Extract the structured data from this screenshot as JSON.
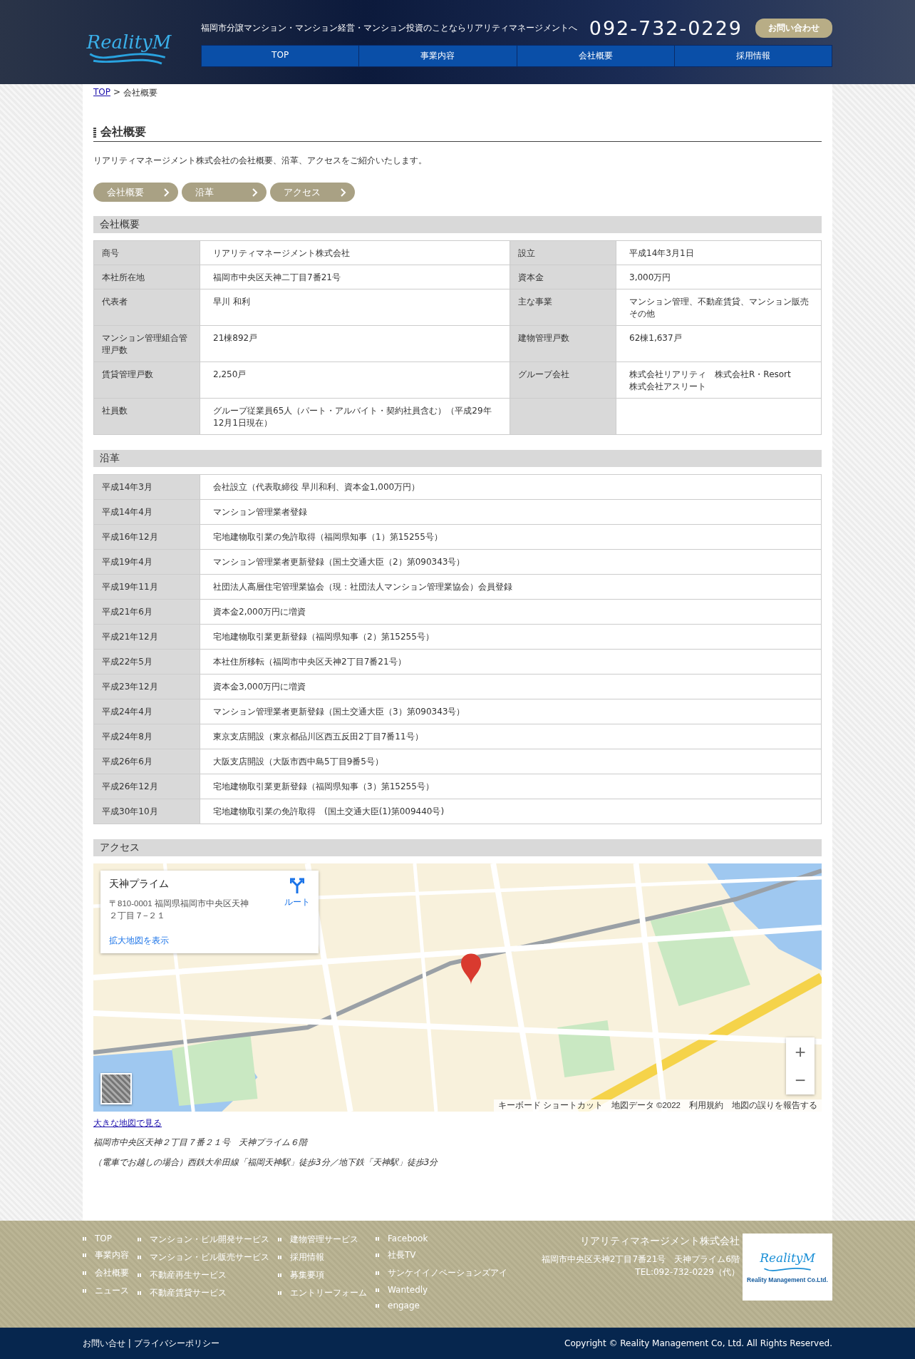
{
  "header": {
    "logo_text": "RealityM",
    "tagline": "福岡市分譲マンション・マンション経営・マンション投資のことならリアリティマネージメントへ",
    "phone": "092-732-0229",
    "contact_button": "お問い合わせ",
    "nav": [
      "TOP",
      "事業内容",
      "会社概要",
      "採用情報"
    ]
  },
  "breadcrumb": {
    "link": "TOP",
    "separator": ">",
    "current": "会社概要"
  },
  "page_title": "会社概要",
  "intro": "リアリティマネージメント株式会社の会社概要、沿革、アクセスをご紹介いたします。",
  "anchors": [
    "会社概要",
    "沿革",
    "アクセス"
  ],
  "company": {
    "heading": "会社概要",
    "rows": [
      {
        "label1": "商号",
        "value1": [
          "リアリティマネージメント株式会社"
        ],
        "label2": "設立",
        "value2": [
          "平成14年3月1日"
        ]
      },
      {
        "label1": "本社所在地",
        "value1": [
          "福岡市中央区天神二丁目7番21号"
        ],
        "label2": "資本金",
        "value2": [
          "3,000万円"
        ]
      },
      {
        "label1": "代表者",
        "value1": [
          "早川 和利"
        ],
        "label2": "主な事業",
        "value2": [
          "マンション管理、不動産賃貸、マンション販売",
          "その他"
        ]
      },
      {
        "label1": "マンション管理組合管理戸数",
        "value1": [
          "21棟892戸"
        ],
        "label2": "建物管理戸数",
        "value2": [
          "62棟1,637戸"
        ]
      },
      {
        "label1": "賃貸管理戸数",
        "value1": [
          "2,250戸"
        ],
        "label2": "グループ会社",
        "value2": [
          "株式会社リアリティ　株式会社R・Resort",
          "株式会社アスリート"
        ]
      },
      {
        "label1": "社員数",
        "value1": [
          "グループ従業員65人（パート・アルバイト・契約社員含む）（平成29年12月1日現在）"
        ]
      }
    ]
  },
  "history": {
    "heading": "沿革",
    "rows": [
      {
        "date": "平成14年3月",
        "event": "会社設立（代表取締役 早川和利、資本金1,000万円）"
      },
      {
        "date": "平成14年4月",
        "event": "マンション管理業者登録"
      },
      {
        "date": "平成16年12月",
        "event": "宅地建物取引業の免許取得（福岡県知事（1）第15255号）"
      },
      {
        "date": "平成19年4月",
        "event": "マンション管理業者更新登録（国土交通大臣（2）第090343号）"
      },
      {
        "date": "平成19年11月",
        "event": "社団法人高層住宅管理業協会（現：社団法人マンション管理業協会）会員登録"
      },
      {
        "date": "平成21年6月",
        "event": "資本金2,000万円に増資"
      },
      {
        "date": "平成21年12月",
        "event": "宅地建物取引業更新登録（福岡県知事（2）第15255号）"
      },
      {
        "date": "平成22年5月",
        "event": "本社住所移転（福岡市中央区天神2丁目7番21号）"
      },
      {
        "date": "平成23年12月",
        "event": "資本金3,000万円に増資"
      },
      {
        "date": "平成24年4月",
        "event": "マンション管理業者更新登録（国土交通大臣（3）第090343号）"
      },
      {
        "date": "平成24年8月",
        "event": "東京支店開設（東京都品川区西五反田2丁目7番11号）"
      },
      {
        "date": "平成26年6月",
        "event": "大阪支店開設（大阪市西中島5丁目9番5号）"
      },
      {
        "date": "平成26年12月",
        "event": "宅地建物取引業更新登録（福岡県知事（3）第15255号）"
      },
      {
        "date": "平成30年10月",
        "event": "宅地建物取引業の免許取得　(国土交通大臣(1)第009440号)"
      }
    ]
  },
  "access": {
    "heading": "アクセス",
    "map": {
      "kind": "picture",
      "place_name": "天神プライム",
      "place_address": "〒810-0001 福岡県福岡市中央区天神２丁目７−２１",
      "route": "ルート",
      "enlarge": "拡大地図を表示",
      "zoom_in": "+",
      "zoom_out": "−",
      "attribution": [
        "キーボード ショートカット",
        "地図データ ©2022",
        "利用規約",
        "地図の誤りを報告する"
      ]
    },
    "map_link": "大きな地図で見る",
    "address_lines": [
      "福岡市中央区天神２丁目７番２１号　天神プライム６階",
      "（電車でお越しの場合）西鉄大牟田線「福岡天神駅」徒歩3分／地下鉄「天神駅」徒歩3分"
    ]
  },
  "footer": {
    "columns": [
      [
        "TOP",
        "事業内容",
        "会社概要",
        "ニュース"
      ],
      [
        "マンション・ビル開発サービス",
        "マンション・ビル販売サービス",
        "不動産再生サービス",
        "不動産賃貸サービス"
      ],
      [
        "建物管理サービス",
        "採用情報",
        "募集要項",
        "エントリーフォーム"
      ],
      [
        "Facebook",
        "社長TV",
        "サンケイイノベーションズアイ",
        "Wantedly",
        "engage"
      ]
    ],
    "company_name": "リアリティマネージメント株式会社",
    "address": "福岡市中央区天神2丁目7番21号　天神プライム6階",
    "tel": "TEL:092-732-0229（代）",
    "logo_text": "RealityM",
    "logo_caption": "Reality Management Co.Ltd.",
    "bottom_links": [
      "お問い合せ",
      "プライバシーポリシー"
    ],
    "bottom_separator": "|",
    "copyright": "Copyright © Reality Management Co, Ltd. All Rights Reserved."
  }
}
